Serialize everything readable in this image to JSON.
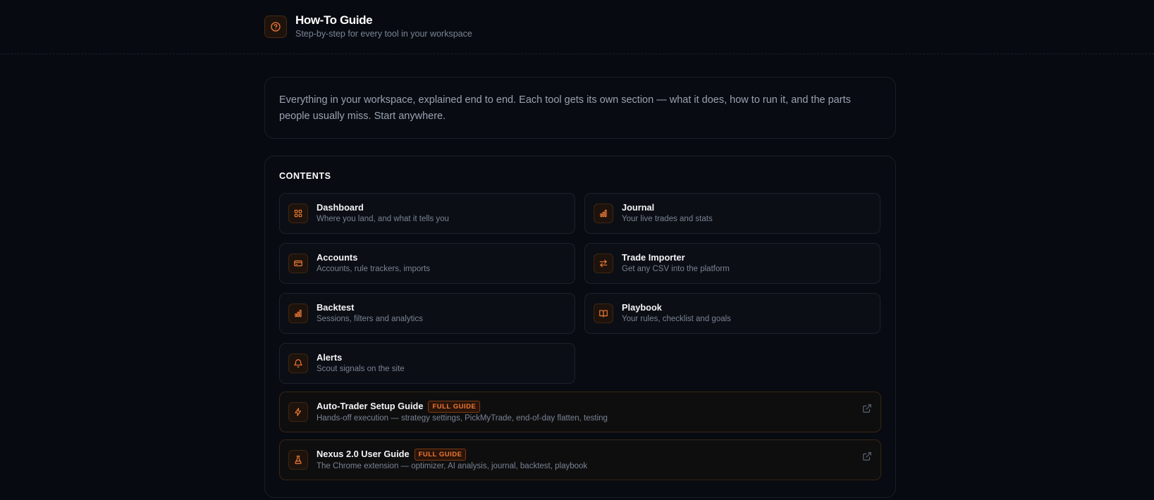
{
  "header": {
    "title": "How-To Guide",
    "subtitle": "Step-by-step for every tool in your workspace",
    "icon": "help-circle-icon"
  },
  "intro": {
    "text": "Everything in your workspace, explained end to end. Each tool gets its own section — what it does, how to run it, and the parts people usually miss. Start anywhere."
  },
  "contents": {
    "heading": "CONTENTS",
    "items": [
      {
        "title": "Dashboard",
        "desc": "Where you land, and what it tells you",
        "icon": "grid-icon"
      },
      {
        "title": "Journal",
        "desc": "Your live trades and stats",
        "icon": "bar-chart-icon"
      },
      {
        "title": "Accounts",
        "desc": "Accounts, rule trackers, imports",
        "icon": "credit-card-icon"
      },
      {
        "title": "Trade Importer",
        "desc": "Get any CSV into the platform",
        "icon": "swap-arrows-icon"
      },
      {
        "title": "Backtest",
        "desc": "Sessions, filters and analytics",
        "icon": "bar-chart-icon"
      },
      {
        "title": "Playbook",
        "desc": "Your rules, checklist and goals",
        "icon": "book-open-icon"
      },
      {
        "title": "Alerts",
        "desc": "Scout signals on the site",
        "icon": "bell-icon"
      }
    ],
    "guides": [
      {
        "title": "Auto-Trader Setup Guide",
        "badge": "FULL GUIDE",
        "desc": "Hands-off execution — strategy settings, PickMyTrade, end-of-day flatten, testing",
        "icon": "lightning-icon"
      },
      {
        "title": "Nexus 2.0 User Guide",
        "badge": "FULL GUIDE",
        "desc": "The Chrome extension — optimizer, AI analysis, journal, backtest, playbook",
        "icon": "flask-icon"
      }
    ]
  },
  "colors": {
    "background": "#070a10",
    "accent": "#f07a35",
    "card_border": "#1a2029",
    "muted_text": "#7a8393"
  }
}
